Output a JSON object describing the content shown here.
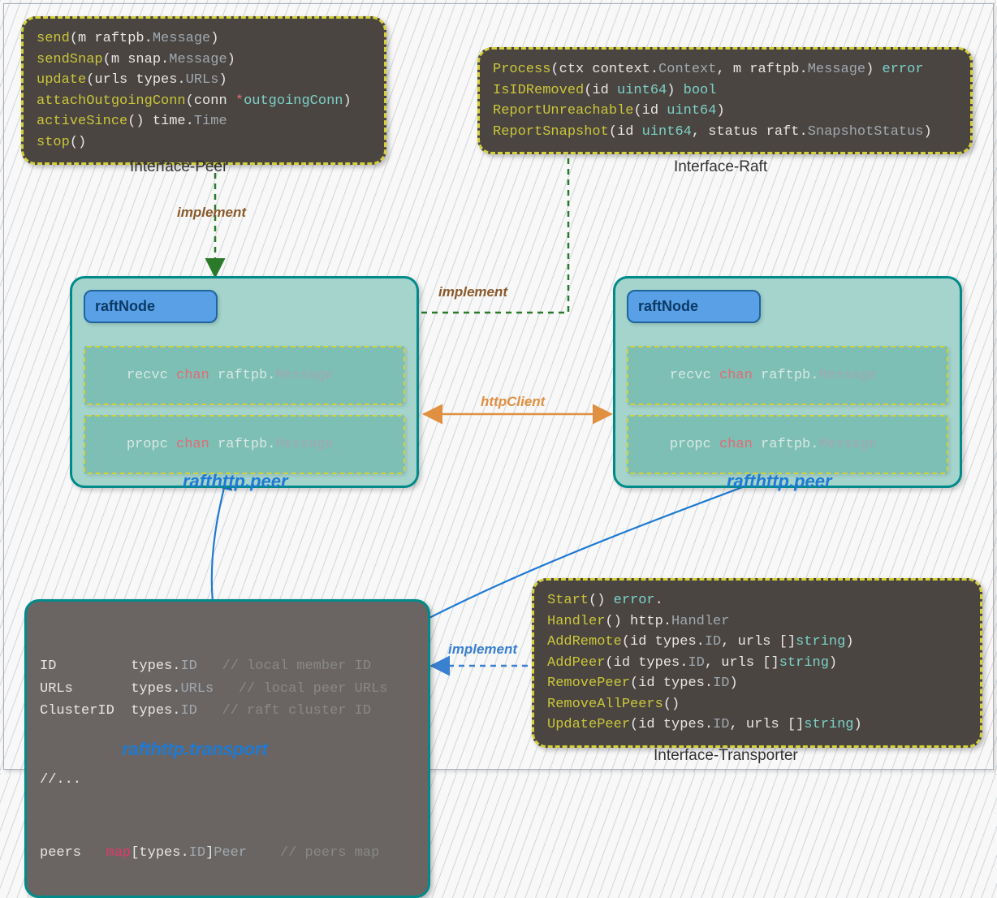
{
  "interfacePeer": {
    "title": "Interface-Peer",
    "lines": [
      [
        {
          "t": "send",
          "c": "kw-yellow"
        },
        {
          "t": "(m ",
          "c": ""
        },
        {
          "t": "raftpb",
          "c": ""
        },
        {
          "t": ".",
          "c": ""
        },
        {
          "t": "Message",
          "c": "kw-type"
        },
        {
          "t": ")",
          "c": ""
        }
      ],
      [
        {
          "t": "sendSnap",
          "c": "kw-yellow"
        },
        {
          "t": "(m snap.",
          "c": ""
        },
        {
          "t": "Message",
          "c": "kw-type"
        },
        {
          "t": ")",
          "c": ""
        }
      ],
      [
        {
          "t": "update",
          "c": "kw-yellow"
        },
        {
          "t": "(urls types.",
          "c": ""
        },
        {
          "t": "URLs",
          "c": "kw-type"
        },
        {
          "t": ")",
          "c": ""
        }
      ],
      [
        {
          "t": "attachOutgoingConn",
          "c": "kw-yellow"
        },
        {
          "t": "(conn ",
          "c": ""
        },
        {
          "t": "*",
          "c": "kw-red"
        },
        {
          "t": "outgoingConn",
          "c": "kw-teal"
        },
        {
          "t": ")",
          "c": ""
        }
      ],
      [
        {
          "t": "activeSince",
          "c": "kw-yellow"
        },
        {
          "t": "() time.",
          "c": ""
        },
        {
          "t": "Time",
          "c": "kw-type"
        },
        {
          "t": "",
          "c": ""
        }
      ],
      [
        {
          "t": "stop",
          "c": "kw-yellow"
        },
        {
          "t": "()",
          "c": ""
        }
      ]
    ]
  },
  "interfaceRaft": {
    "title": "Interface-Raft",
    "lines": [
      [
        {
          "t": "Process",
          "c": "kw-yellow"
        },
        {
          "t": "(ctx context.",
          "c": ""
        },
        {
          "t": "Context",
          "c": "kw-type"
        },
        {
          "t": ", m raftpb.",
          "c": ""
        },
        {
          "t": "Message",
          "c": "kw-type"
        },
        {
          "t": ") ",
          "c": ""
        },
        {
          "t": "error",
          "c": "kw-teal"
        }
      ],
      [
        {
          "t": "IsIDRemoved",
          "c": "kw-yellow"
        },
        {
          "t": "(id ",
          "c": ""
        },
        {
          "t": "uint64",
          "c": "kw-teal"
        },
        {
          "t": ") ",
          "c": ""
        },
        {
          "t": "bool",
          "c": "kw-teal"
        }
      ],
      [
        {
          "t": "ReportUnreachable",
          "c": "kw-yellow"
        },
        {
          "t": "(id ",
          "c": ""
        },
        {
          "t": "uint64",
          "c": "kw-teal"
        },
        {
          "t": ")",
          "c": ""
        }
      ],
      [
        {
          "t": "ReportSnapshot",
          "c": "kw-yellow"
        },
        {
          "t": "(id ",
          "c": ""
        },
        {
          "t": "uint64",
          "c": "kw-teal"
        },
        {
          "t": ", status raft.",
          "c": ""
        },
        {
          "t": "SnapshotStatus",
          "c": "kw-type"
        },
        {
          "t": ")",
          "c": ""
        }
      ]
    ]
  },
  "interfaceTransporter": {
    "title": "Interface-Transporter",
    "lines": [
      [
        {
          "t": "Start",
          "c": "kw-yellow"
        },
        {
          "t": "() ",
          "c": ""
        },
        {
          "t": "error",
          "c": "kw-teal"
        },
        {
          "t": ".",
          "c": ""
        }
      ],
      [
        {
          "t": "Handler",
          "c": "kw-yellow"
        },
        {
          "t": "() http.",
          "c": ""
        },
        {
          "t": "Handler",
          "c": "kw-type"
        }
      ],
      [
        {
          "t": "AddRemote",
          "c": "kw-yellow"
        },
        {
          "t": "(id types.",
          "c": ""
        },
        {
          "t": "ID",
          "c": "kw-type"
        },
        {
          "t": ", urls []",
          "c": ""
        },
        {
          "t": "string",
          "c": "kw-teal"
        },
        {
          "t": ")",
          "c": ""
        }
      ],
      [
        {
          "t": "AddPeer",
          "c": "kw-yellow"
        },
        {
          "t": "(id types.",
          "c": ""
        },
        {
          "t": "ID",
          "c": "kw-type"
        },
        {
          "t": ", urls []",
          "c": ""
        },
        {
          "t": "string",
          "c": "kw-teal"
        },
        {
          "t": ")",
          "c": ""
        }
      ],
      [
        {
          "t": "RemovePeer",
          "c": "kw-yellow"
        },
        {
          "t": "(id types.",
          "c": ""
        },
        {
          "t": "ID",
          "c": "kw-type"
        },
        {
          "t": ")",
          "c": ""
        }
      ],
      [
        {
          "t": "RemoveAllPeers",
          "c": "kw-yellow"
        },
        {
          "t": "()",
          "c": ""
        }
      ],
      [
        {
          "t": "UpdatePeer",
          "c": "kw-yellow"
        },
        {
          "t": "(id types.",
          "c": ""
        },
        {
          "t": "ID",
          "c": "kw-type"
        },
        {
          "t": ", urls []",
          "c": ""
        },
        {
          "t": "string",
          "c": "kw-teal"
        },
        {
          "t": ")",
          "c": ""
        }
      ]
    ]
  },
  "peerLeft": {
    "title": "rafthttp.peer",
    "raftNode": "raftNode",
    "recvc": {
      "name": "recvc",
      "kw": "chan",
      "pkg": "raftpb",
      "type": "Message"
    },
    "propc": {
      "name": "propc",
      "kw": "chan",
      "pkg": "raftpb",
      "type": "Message"
    }
  },
  "peerRight": {
    "title": "rafthttp.peer",
    "raftNode": "raftNode",
    "recvc": {
      "name": "recvc",
      "kw": "chan",
      "pkg": "raftpb",
      "type": "Message"
    },
    "propc": {
      "name": "propc",
      "kw": "chan",
      "pkg": "raftpb",
      "type": "Message"
    }
  },
  "transport": {
    "title": "rafthttp.transport",
    "rows": [
      {
        "name": "ID",
        "type": "types.",
        "tt": "ID",
        "comment": "// local member ID"
      },
      {
        "name": "URLs",
        "type": "types.",
        "tt": "URLs",
        "comment": "// local peer URLs"
      },
      {
        "name": "ClusterID",
        "type": "types.",
        "tt": "ID",
        "comment": "// raft cluster ID"
      }
    ],
    "ellipsis": "//...",
    "peersLine": {
      "name": "peers",
      "pre": "map",
      "mid": "[types.",
      "id": "ID",
      "close": "]",
      "peer": "Peer",
      "comment": "// peers map"
    }
  },
  "edges": {
    "implement1": "implement",
    "implement2": "implement",
    "implement3": "implement",
    "httpClient": "httpClient"
  }
}
